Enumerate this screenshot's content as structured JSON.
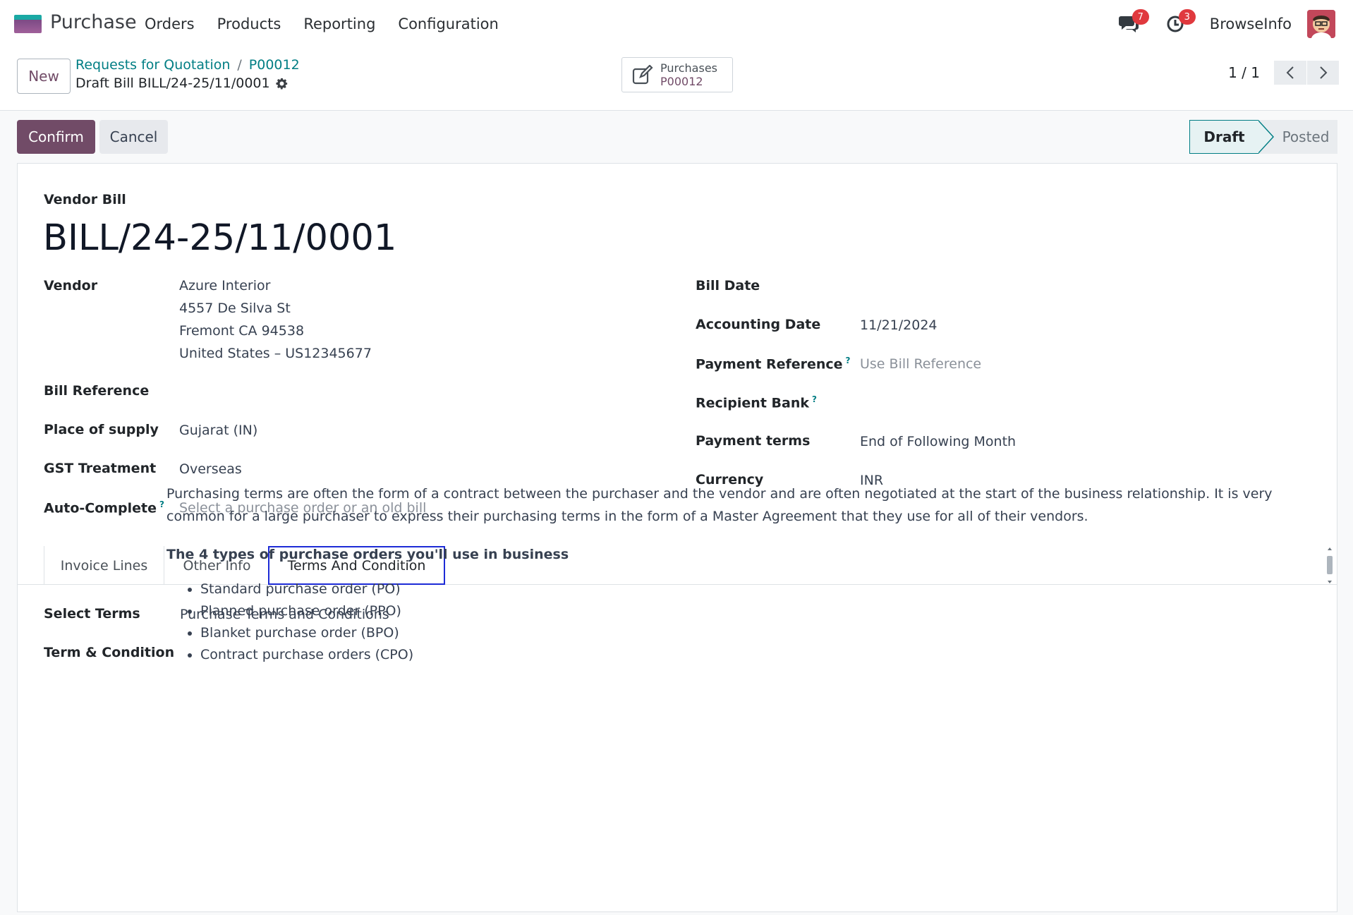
{
  "navbar": {
    "app_name": "Purchase",
    "menu": [
      "Orders",
      "Products",
      "Reporting",
      "Configuration"
    ],
    "messages_count": "7",
    "activities_count": "3",
    "company": "BrowseInfo"
  },
  "control": {
    "new_label": "New",
    "breadcrumb": [
      "Requests for Quotation",
      "P00012"
    ],
    "current": "Draft Bill BILL/24-25/11/0001",
    "smart_button": {
      "label": "Purchases",
      "value": "P00012"
    },
    "pager": "1 / 1"
  },
  "actions": {
    "confirm": "Confirm",
    "cancel": "Cancel",
    "status": [
      "Draft",
      "Posted"
    ],
    "active_status": "Draft"
  },
  "form": {
    "doc_type": "Vendor Bill",
    "name": "BILL/24-25/11/0001",
    "left": {
      "vendor_label": "Vendor",
      "vendor_lines": [
        "Azure Interior",
        "4557 De Silva St",
        "Fremont CA 94538",
        "United States – US12345677"
      ],
      "bill_ref_label": "Bill Reference",
      "place_label": "Place of supply",
      "place_value": "Gujarat (IN)",
      "gst_label": "GST Treatment",
      "gst_value": "Overseas",
      "autocomplete_label": "Auto-Complete",
      "autocomplete_placeholder": "Select a purchase order or an old bill"
    },
    "right": {
      "bill_date_label": "Bill Date",
      "acc_date_label": "Accounting Date",
      "acc_date_value": "11/21/2024",
      "pay_ref_label": "Payment Reference",
      "pay_ref_placeholder": "Use Bill Reference",
      "bank_label": "Recipient Bank",
      "terms_label": "Payment terms",
      "terms_value": "End of Following Month",
      "currency_label": "Currency",
      "currency_value": "INR"
    },
    "help_mark": "?"
  },
  "tabs": [
    "Invoice Lines",
    "Other Info",
    "Terms And Condition"
  ],
  "active_tab": "Terms And Condition",
  "terms_tab": {
    "select_label": "Select Terms",
    "select_value": "Purchase Terms and Conditions",
    "tc_label": "Term & Condition",
    "paragraph": "Purchasing terms are often the form of a contract between the purchaser and the vendor and are often negotiated at the start of the business relationship. It is very common for a large purchaser to express their purchasing terms in the form of a Master Agreement that they use for all of their vendors.",
    "heading": "The 4 types of purchase orders you'll use in business",
    "items": [
      "Standard purchase order (PO)",
      "Planned purchase order (PPO)",
      "Blanket purchase order (BPO)",
      "Contract purchase orders (CPO)"
    ]
  },
  "colors": {
    "brand": "#714b67",
    "link": "#017e84",
    "badge": "#e0393e",
    "active_tab_border": "#1d2bd6"
  }
}
